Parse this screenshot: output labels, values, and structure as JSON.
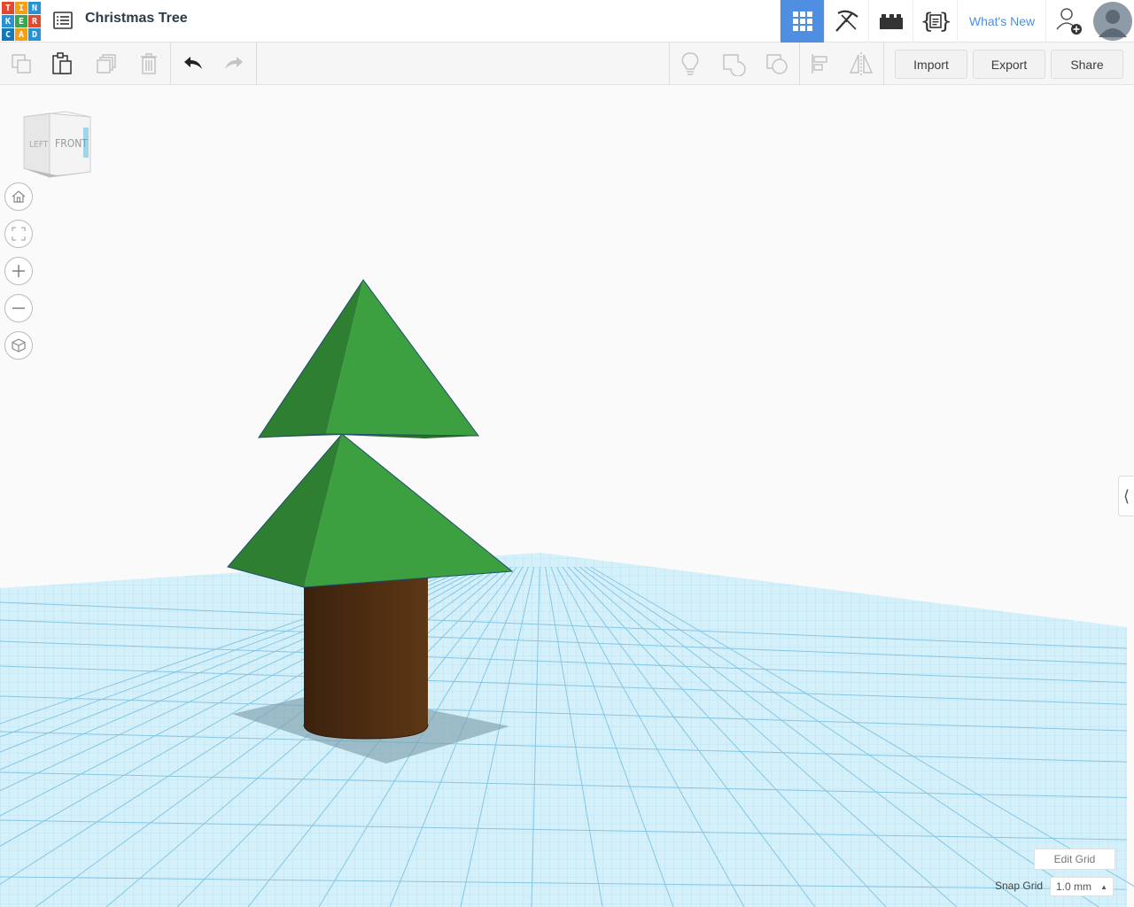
{
  "app": {
    "logo_letters": [
      "T",
      "I",
      "N",
      "K",
      "E",
      "R",
      "C",
      "A",
      "D"
    ],
    "design_title": "Christmas Tree"
  },
  "header": {
    "whats_new_label": "What's New",
    "icons": [
      "grid-view-icon",
      "pickaxe-icon",
      "brick-icon",
      "code-blocks-icon",
      "add-user-icon",
      "user-avatar"
    ]
  },
  "toolbar": {
    "import_label": "Import",
    "export_label": "Export",
    "share_label": "Share",
    "tools": [
      "copy-icon",
      "paste-icon",
      "duplicate-icon",
      "delete-icon",
      "undo-icon",
      "redo-icon",
      "notes-icon",
      "group-icon",
      "ungroup-icon",
      "align-icon",
      "mirror-icon"
    ]
  },
  "viewcube": {
    "left_label": "LEFT",
    "front_label": "FRONT"
  },
  "nav_controls": [
    "home-view-icon",
    "fit-all-icon",
    "zoom-in-icon",
    "zoom-out-icon",
    "perspective-icon"
  ],
  "workplane": {
    "edit_grid_label": "Edit Grid",
    "snap_grid_label": "Snap Grid",
    "snap_grid_value": "1.0 mm"
  },
  "colors": {
    "accent": "#4f8ee0",
    "tree_green": "#3da040",
    "tree_green_dark": "#2f7f33",
    "trunk_brown": "#4f2f14",
    "grid_blue": "#bfe6f5"
  }
}
